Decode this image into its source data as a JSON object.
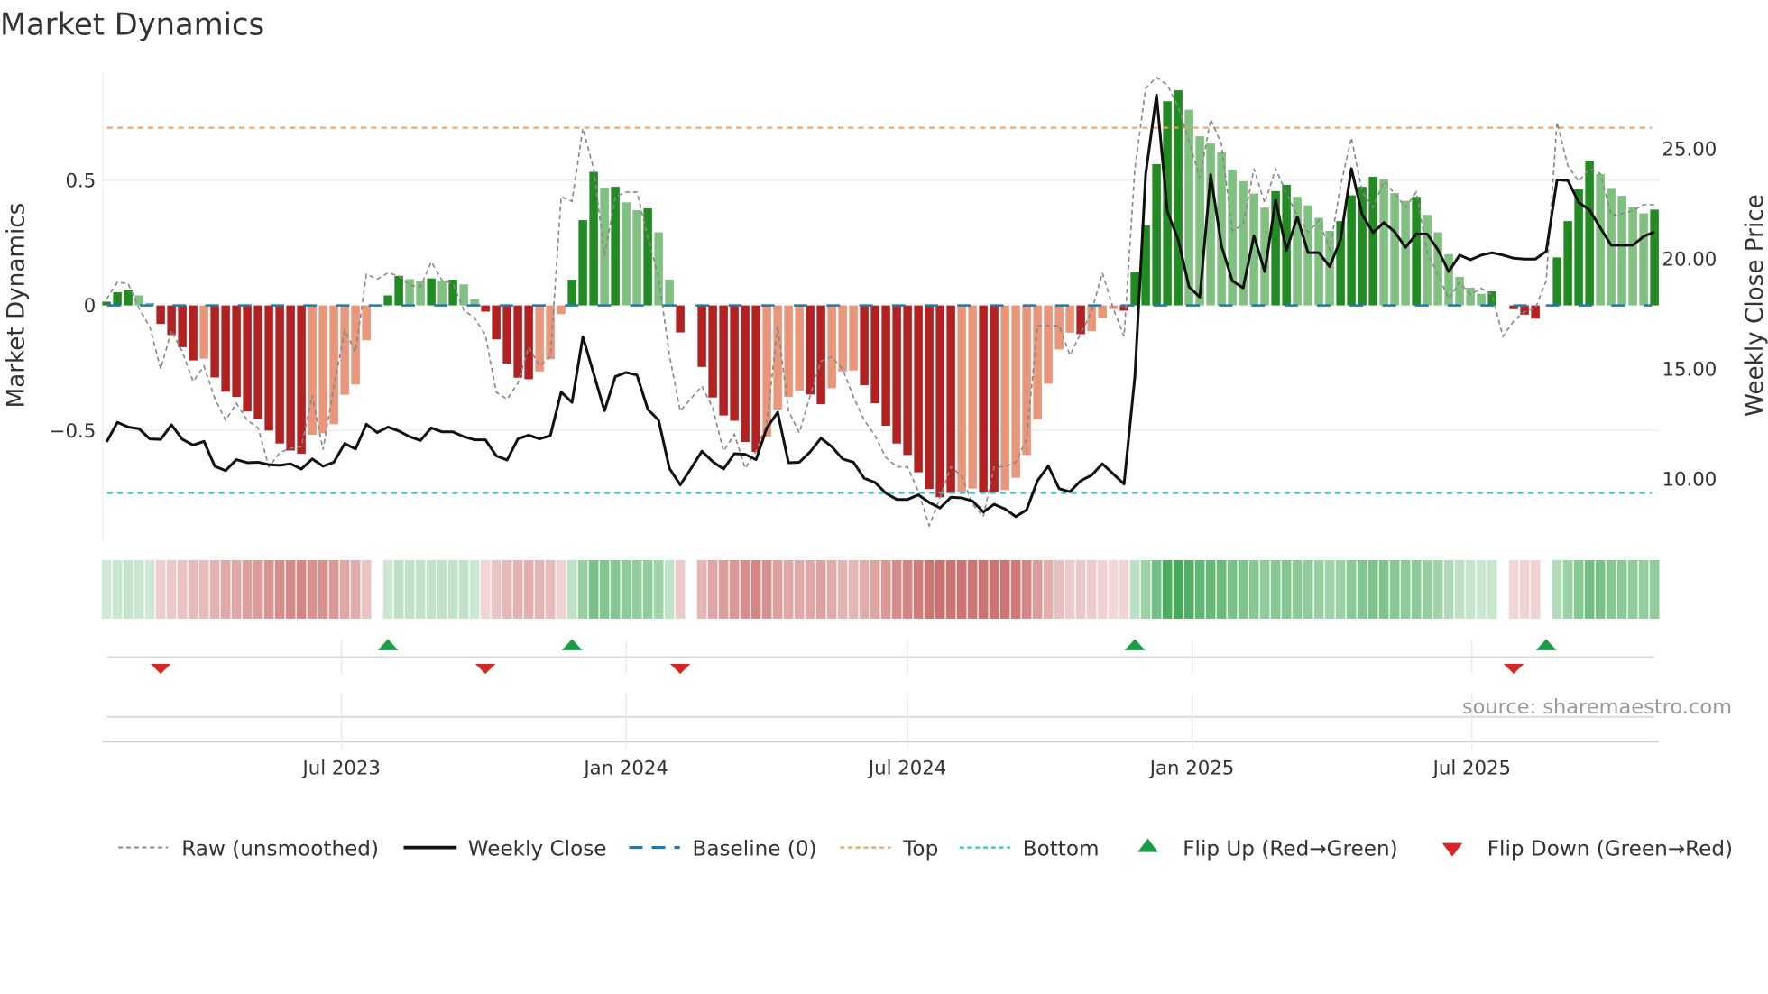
{
  "chart_data": {
    "type": "bar",
    "title": "Market Dynamics",
    "ylabel": "Market Dynamics",
    "y2label": "Weekly Close Price",
    "ylim": [
      -0.95,
      0.93
    ],
    "y2lim": [
      7.2,
      28.5
    ],
    "start_date": "2023-01-30",
    "y_ticks": [
      {
        "value": 0.5,
        "label": "0.5"
      },
      {
        "value": 0,
        "label": "0"
      },
      {
        "value": -0.5,
        "label": "−0.5"
      }
    ],
    "y2_ticks": [
      {
        "value": 25,
        "label": "25.00"
      },
      {
        "value": 20,
        "label": "20.00"
      },
      {
        "value": 15,
        "label": "15.00"
      },
      {
        "value": 10,
        "label": "10.00"
      }
    ],
    "x_ticks": [
      {
        "date": "2023-07-01",
        "label": "Jul 2023"
      },
      {
        "date": "2024-01-01",
        "label": "Jan 2024"
      },
      {
        "date": "2024-07-01",
        "label": "Jul 2024"
      },
      {
        "date": "2025-01-01",
        "label": "Jan 2025"
      },
      {
        "date": "2025-07-01",
        "label": "Jul 2025"
      }
    ],
    "top_level": 0.71,
    "bottom_level": -0.75,
    "baseline": 0,
    "bars": [
      0.015,
      0.053,
      0.063,
      0.04,
      0.01,
      -0.074,
      -0.118,
      -0.167,
      -0.22,
      -0.213,
      -0.288,
      -0.345,
      -0.366,
      -0.424,
      -0.453,
      -0.5,
      -0.552,
      -0.58,
      -0.593,
      -0.517,
      -0.511,
      -0.475,
      -0.357,
      -0.316,
      -0.139,
      0,
      0.04,
      0.118,
      0.105,
      0.096,
      0.108,
      0.1,
      0.103,
      0.084,
      0.025,
      -0.025,
      -0.136,
      -0.232,
      -0.289,
      -0.295,
      -0.264,
      -0.215,
      -0.035,
      0.103,
      0.341,
      0.534,
      0.471,
      0.474,
      0.412,
      0.381,
      0.388,
      0.292,
      0.103,
      -0.108,
      0,
      -0.246,
      -0.368,
      -0.44,
      -0.461,
      -0.546,
      -0.586,
      -0.525,
      -0.416,
      -0.366,
      -0.341,
      -0.356,
      -0.395,
      -0.331,
      -0.264,
      -0.26,
      -0.319,
      -0.391,
      -0.481,
      -0.552,
      -0.598,
      -0.667,
      -0.734,
      -0.767,
      -0.75,
      -0.744,
      -0.732,
      -0.747,
      -0.747,
      -0.738,
      -0.689,
      -0.598,
      -0.456,
      -0.313,
      -0.176,
      -0.109,
      -0.115,
      -0.103,
      -0.05,
      -0.015,
      -0.021,
      0.133,
      0.32,
      0.565,
      0.816,
      0.86,
      0.782,
      0.676,
      0.648,
      0.612,
      0.542,
      0.496,
      0.447,
      0.391,
      0.457,
      0.482,
      0.434,
      0.4,
      0.35,
      0.298,
      0.337,
      0.44,
      0.474,
      0.514,
      0.505,
      0.449,
      0.418,
      0.434,
      0.362,
      0.292,
      0.205,
      0.114,
      0.071,
      0.046,
      0.056,
      0,
      -0.015,
      -0.037,
      -0.053,
      0,
      0.192,
      0.337,
      0.465,
      0.579,
      0.525,
      0.469,
      0.438,
      0.393,
      0.368,
      0.383
    ],
    "bar_shade": "DDDLLDDDDLDDDDDDDDDLLLLLLLDDLLDLDLLDDDDDLLLDDDLDLLDLLDLDDDDDDLLLLDDLLLDDDDDDDDDLLDDLLLLLLLDLLLDDDDDDLLLLLLLLDDLLLLDDDDLLLDLLLLLLDLDDDLDDDDLLLLLD",
    "weekly_close": [
      11.68,
      12.57,
      12.36,
      12.28,
      11.82,
      11.8,
      12.46,
      11.8,
      11.54,
      11.71,
      10.58,
      10.38,
      10.88,
      10.74,
      10.76,
      10.65,
      10.62,
      10.69,
      10.45,
      10.91,
      10.58,
      10.76,
      11.61,
      11.36,
      12.49,
      12.11,
      12.36,
      12.18,
      11.92,
      11.75,
      12.32,
      12.14,
      12.14,
      11.92,
      11.78,
      11.78,
      11.05,
      10.86,
      11.82,
      11.99,
      11.82,
      11.97,
      13.95,
      13.48,
      16.46,
      14.79,
      13.1,
      14.65,
      14.84,
      14.72,
      13.17,
      12.67,
      10.48,
      9.73,
      10.48,
      11.26,
      10.79,
      10.45,
      11.15,
      11.12,
      10.88,
      12.32,
      13.03,
      10.74,
      10.76,
      11.23,
      11.85,
      11.47,
      10.91,
      10.76,
      10.03,
      9.84,
      9.35,
      9.07,
      9.07,
      9.28,
      8.93,
      8.68,
      9.17,
      9.14,
      9.0,
      8.5,
      8.85,
      8.64,
      8.29,
      8.6,
      9.92,
      10.59,
      9.56,
      9.42,
      9.92,
      10.17,
      10.69,
      10.23,
      9.77,
      14.65,
      23.85,
      27.45,
      22.15,
      20.88,
      18.73,
      18.26,
      23.82,
      20.59,
      19.0,
      18.68,
      21.05,
      19.42,
      22.67,
      20.38,
      21.9,
      20.28,
      20.28,
      19.65,
      20.88,
      24.1,
      22.01,
      21.19,
      21.65,
      21.23,
      20.52,
      21.13,
      21.13,
      20.41,
      19.42,
      20.17,
      19.96,
      20.17,
      20.28,
      20.17,
      20.03,
      19.99,
      19.99,
      20.34,
      23.59,
      23.56,
      22.57,
      22.22,
      21.41,
      20.62,
      20.62,
      20.62,
      21.02,
      21.23
    ],
    "raw": [
      0.025,
      0.093,
      0.087,
      -0.012,
      -0.087,
      -0.254,
      -0.1,
      -0.186,
      -0.304,
      -0.242,
      -0.372,
      -0.459,
      -0.391,
      -0.459,
      -0.49,
      -0.645,
      -0.589,
      -0.571,
      -0.565,
      -0.36,
      -0.577,
      -0.323,
      -0.1,
      -0.186,
      0.124,
      0.105,
      0.13,
      0.118,
      0.08,
      0.074,
      0.174,
      0.1,
      0.087,
      -0.019,
      -0.05,
      -0.118,
      -0.347,
      -0.375,
      -0.31,
      -0.167,
      -0.242,
      -0.205,
      0.434,
      0.416,
      0.707,
      0.546,
      0.199,
      0.434,
      0.453,
      0.453,
      0.273,
      0.112,
      -0.199,
      -0.422,
      -0.372,
      -0.323,
      -0.409,
      -0.583,
      -0.515,
      -0.651,
      -0.583,
      -0.471,
      -0.081,
      -0.422,
      -0.509,
      -0.36,
      -0.223,
      -0.205,
      -0.254,
      -0.366,
      -0.459,
      -0.521,
      -0.608,
      -0.645,
      -0.645,
      -0.744,
      -0.881,
      -0.769,
      -0.645,
      -0.682,
      -0.794,
      -0.844,
      -0.645,
      -0.645,
      -0.627,
      -0.534,
      -0.081,
      -0.081,
      -0.081,
      -0.199,
      -0.112,
      -0.025,
      0.13,
      -0.012,
      -0.124,
      0.546,
      0.868,
      0.912,
      0.881,
      0.794,
      0.658,
      0.509,
      0.744,
      0.645,
      0.298,
      0.323,
      0.546,
      0.409,
      0.546,
      0.447,
      0.36,
      0.292,
      0.341,
      0.223,
      0.478,
      0.67,
      0.453,
      0.391,
      0.496,
      0.447,
      0.391,
      0.453,
      0.211,
      0.124,
      0.025,
      0.093,
      0.043,
      0.068,
      0.043,
      -0.124,
      -0.062,
      -0.025,
      -0.012,
      0.099,
      0.732,
      0.558,
      0.496,
      0.546,
      0.527,
      0.36,
      0.366,
      0.378,
      0.403,
      0.403
    ],
    "flip_up_weeks": [
      26,
      43,
      95,
      133
    ],
    "flip_down_weeks": [
      5,
      35,
      53,
      130
    ],
    "legend": {
      "raw": "Raw (unsmoothed)",
      "close": "Weekly Close",
      "baseline": "Baseline (0)",
      "top": "Top",
      "bottom": "Bottom",
      "flip_up": "Flip Up (Red→Green)",
      "flip_down": "Flip Down (Green→Red)"
    },
    "legend_placement": "bottom",
    "source": "source: sharemaestro.com",
    "colors": {
      "green_dark": "#228b22",
      "green_light": "#80c080",
      "red_dark": "#b22222",
      "red_light": "#e9967a",
      "heat_green": "#2e9e44",
      "heat_red": "#c0504d",
      "top": "#f0a060",
      "bottom": "#2bc4d8",
      "baseline": "#1f77b4",
      "raw": "#888888",
      "close": "#111111",
      "flip_up": "#1a9e45",
      "flip_down": "#d62728"
    }
  }
}
